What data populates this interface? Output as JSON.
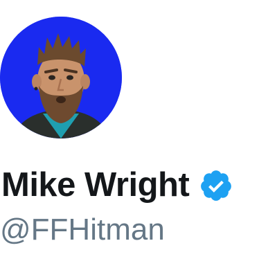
{
  "profile": {
    "display_name": "Mike Wright",
    "handle": "@FFHitman",
    "verified": true,
    "avatar_background": "#1a2af0",
    "verified_color": "#1da1f2"
  },
  "colors": {
    "name_text": "#14171a",
    "handle_text": "#657786",
    "page_background": "#ffffff"
  },
  "icons": {
    "verified_badge": "verified-badge-icon",
    "avatar": "profile-avatar"
  }
}
